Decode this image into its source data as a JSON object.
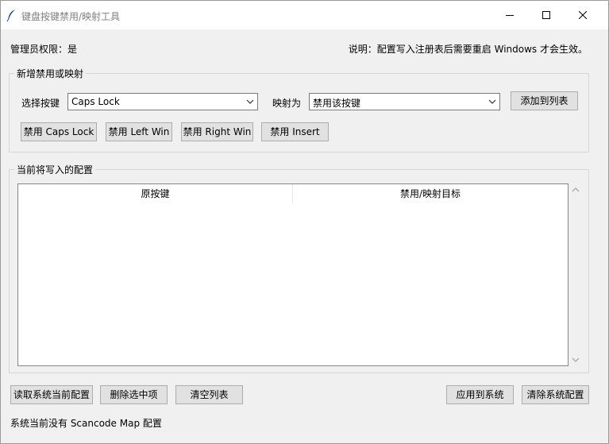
{
  "window": {
    "title": "键盘按键禁用/映射工具",
    "icons": {
      "app": "feather-icon",
      "minimize": "minimize-icon",
      "maximize": "maximize-icon",
      "close": "close-icon"
    }
  },
  "info": {
    "admin": "管理员权限：是",
    "note": "说明：配置写入注册表后需要重启 Windows 才会生效。"
  },
  "add_group": {
    "title": "新增禁用或映射",
    "select_key_label": "选择按键",
    "select_key_value": "Caps Lock",
    "map_to_label": "映射为",
    "map_to_value": "禁用该按键",
    "add_button": "添加到列表",
    "quick_buttons": [
      "禁用 Caps Lock",
      "禁用 Left Win",
      "禁用 Right Win",
      "禁用 Insert"
    ]
  },
  "config_group": {
    "title": "当前将写入的配置",
    "columns": [
      "原按键",
      "禁用/映射目标"
    ],
    "rows": []
  },
  "actions": {
    "read": "读取系统当前配置",
    "delete": "删除选中项",
    "clear": "清空列表",
    "apply": "应用到系统",
    "clear_system": "清除系统配置"
  },
  "status": "系统当前没有 Scancode Map 配置"
}
